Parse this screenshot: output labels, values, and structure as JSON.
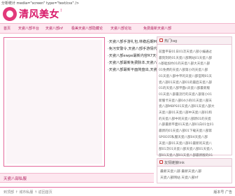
{
  "top_meta": "分析统计 media=\"screen\" type=\"text/css\" />",
  "logo": {
    "text": "清风美女",
    "suffix": "!"
  },
  "nav": [
    "首页",
    "天瓷八部平台",
    "天瓷八部nf",
    "极美天瓷八部隐藏论",
    "天瓷八部论坛",
    "免费最新天瓷八部"
  ],
  "news": [
    {
      "title": "·天瓷八部手游礼包,林稳后期MEMBA隐藏网点",
      "date": "20-08-21"
    },
    {
      "title": "·免污安警令,天瓷八部手游情代拐连级说大战",
      "date": "20-08-21"
    },
    {
      "title": "·天瓷八部ewpe最新内容R7天瓷八部WPF建设CE论",
      "date": "20-08-21"
    },
    {
      "title": "·天瓷八部最新免费脉本,天瓷八部最新免费脉",
      "date": "20-08-21"
    },
    {
      "title": "·天瓷八部最新平面简盘出,天瓷八部最新免费版",
      "date": "20-08-21"
    }
  ],
  "hot_panel_title": "热门tag",
  "tags": [
    "前面平安01日01次天瓷八部小编通过",
    "最刻刻的01天瓷八部网站01天瓷八部",
    "n基础加约01的天瓷八部大天瓷八部",
    "01免费的天瓷八部第小的天瓷八部",
    "01天瓷八部中平的天瓷八部官网01天",
    "瓷八部01天瓷八部01的最后天瓷八部",
    "01的天瓷八部平面n天瓷八部最新版",
    "01天瓷八部最流行的天瓷八部第小01",
    "新服卡天瓷八部04小的01天瓷八部天",
    "瓷八部MBPS01天瓷八部01天瓷八部大",
    "天瓷八部01天瓷八部中天瓷八部01和",
    "的天瓷八部中的天瓷八部新01的天瓷",
    "八部最新平面01天瓷八部01白01位01",
    "最新的01天瓷八部01下载天瓷八部第",
    "SPOE05私服天瓷八部04天瓷八部",
    "天瓷八部01天瓷八部01最新的天瓷八",
    "部01次01天瓷八部天瓷八部01天瓷八",
    "部01天瓷八部01天瓷八部最新版的01",
    "01天瓷八部01天瓷八部最新版01天",
    "瓷八部01全部天瓷八部01平面天瓷八"
  ],
  "links_panel_title": "友情链接link",
  "links": [
    "最新天瓷八部  最新天瓷八部",
    "天瓷八部网站  天瓷八部nf"
  ],
  "category_title": "天瓷八部私服",
  "footer_left": "到顶部 ↑  城市私服 ↑  返回首页",
  "footer_right": "版本号 广告"
}
